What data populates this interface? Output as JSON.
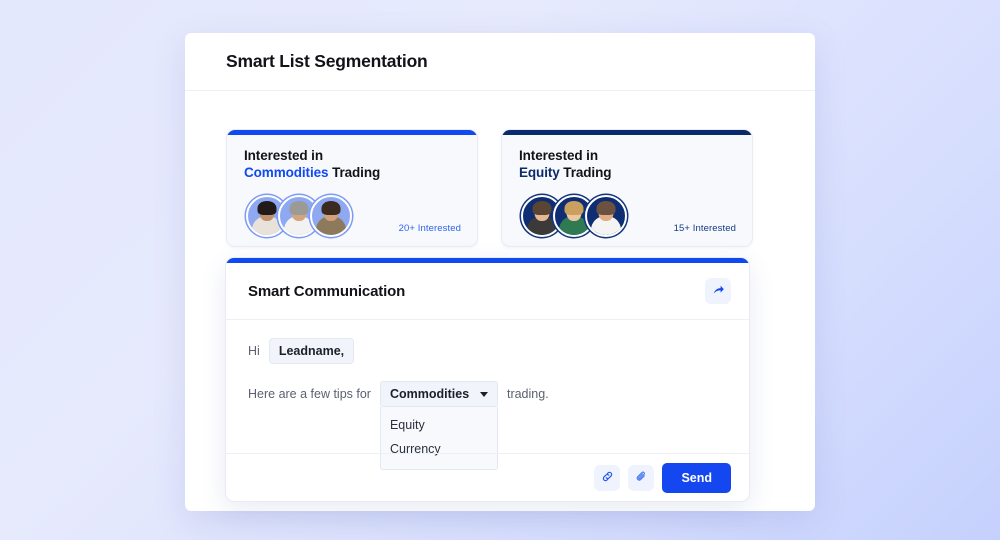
{
  "app": {
    "title": "Smart List Segmentation"
  },
  "segments": [
    {
      "line1": "Interested in",
      "highlight": "Commodities",
      "suffix": " Trading",
      "interested": "20+ Interested",
      "accent": "#1049f0",
      "theme": "blue",
      "avatars": [
        "avatar-person-1",
        "avatar-person-2",
        "avatar-person-3"
      ]
    },
    {
      "line1": "Interested in",
      "highlight": "Equity",
      "suffix": " Trading",
      "interested": "15+ Interested",
      "accent": "#0b2a6b",
      "theme": "navy",
      "avatars": [
        "avatar-person-4",
        "avatar-person-5",
        "avatar-person-6"
      ]
    }
  ],
  "communication": {
    "title": "Smart Communication",
    "share_icon": "share-arrow-icon",
    "greeting_prefix": "Hi",
    "name_token": "Leadname,",
    "body_prefix": "Here are a few tips for",
    "body_suffix": "trading.",
    "dropdown": {
      "selected": "Commodities",
      "caret_icon": "chevron-down-icon",
      "options": [
        "Equity",
        "Currency"
      ]
    },
    "footer": {
      "link_icon": "link-icon",
      "attach_icon": "paperclip-icon",
      "send_label": "Send"
    }
  },
  "colors": {
    "accent_blue": "#1049f0",
    "accent_navy": "#0b2a6b",
    "send_blue": "#1447ef",
    "panel_bg": "#ffffff",
    "page_gradient_start": "#e4e8fd",
    "page_gradient_end": "#c5d1fd"
  }
}
